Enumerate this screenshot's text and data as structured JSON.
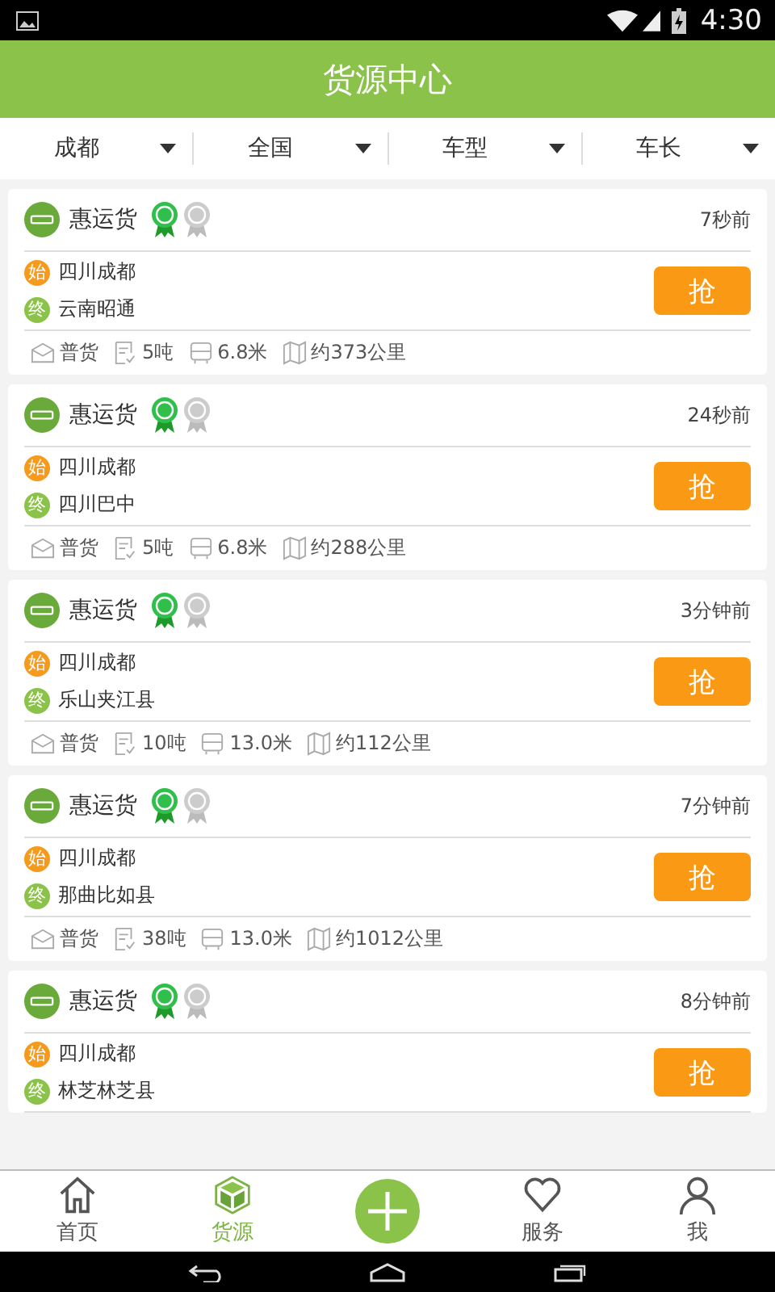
{
  "status_bar": {
    "time": "4:30"
  },
  "header": {
    "title": "货源中心"
  },
  "filters": [
    {
      "label": "成都"
    },
    {
      "label": "全国"
    },
    {
      "label": "车型"
    },
    {
      "label": "车长"
    }
  ],
  "cargo_list": [
    {
      "company": "惠运货",
      "time": "7秒前",
      "start_mark": "始",
      "start": "四川成都",
      "end_mark": "终",
      "end": "云南昭通",
      "grab": "抢",
      "specs": {
        "type": "普货",
        "weight": "5吨",
        "length": "6.8米",
        "distance": "约373公里"
      }
    },
    {
      "company": "惠运货",
      "time": "24秒前",
      "start_mark": "始",
      "start": "四川成都",
      "end_mark": "终",
      "end": "四川巴中",
      "grab": "抢",
      "specs": {
        "type": "普货",
        "weight": "5吨",
        "length": "6.8米",
        "distance": "约288公里"
      }
    },
    {
      "company": "惠运货",
      "time": "3分钟前",
      "start_mark": "始",
      "start": "四川成都",
      "end_mark": "终",
      "end": "乐山夹江县",
      "grab": "抢",
      "specs": {
        "type": "普货",
        "weight": "10吨",
        "length": "13.0米",
        "distance": "约112公里"
      }
    },
    {
      "company": "惠运货",
      "time": "7分钟前",
      "start_mark": "始",
      "start": "四川成都",
      "end_mark": "终",
      "end": "那曲比如县",
      "grab": "抢",
      "specs": {
        "type": "普货",
        "weight": "38吨",
        "length": "13.0米",
        "distance": "约1012公里"
      }
    },
    {
      "company": "惠运货",
      "time": "8分钟前",
      "start_mark": "始",
      "start": "四川成都",
      "end_mark": "终",
      "end": "林芝林芝县",
      "grab": "抢"
    }
  ],
  "tab_bar": [
    {
      "kind": "home",
      "label": "首页",
      "selected": false
    },
    {
      "kind": "cargo",
      "label": "货源",
      "selected": true
    },
    {
      "kind": "add"
    },
    {
      "kind": "service",
      "label": "服务",
      "selected": false
    },
    {
      "kind": "me",
      "label": "我",
      "selected": false
    }
  ]
}
